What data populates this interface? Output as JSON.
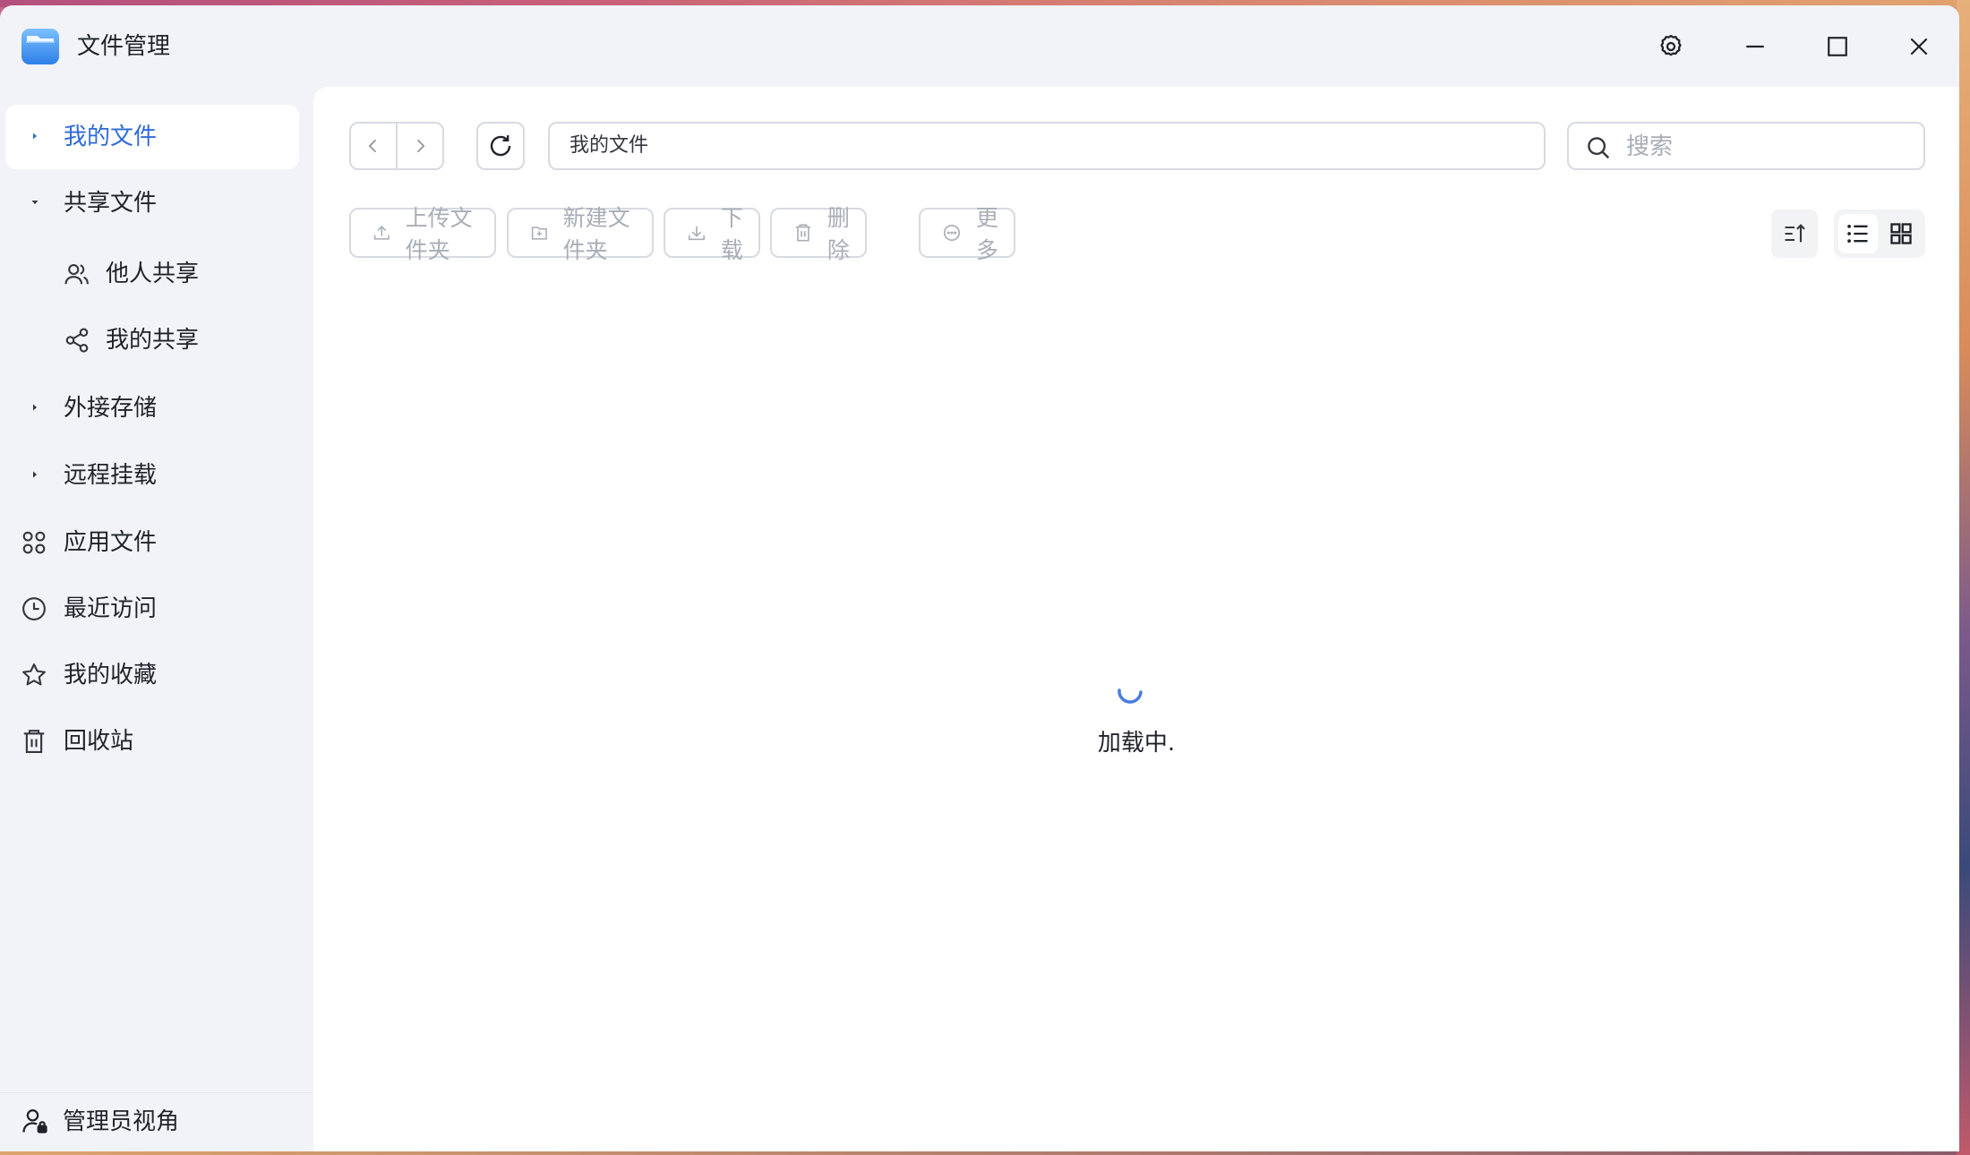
{
  "window": {
    "title": "文件管理",
    "icon": "folder-app-icon"
  },
  "titlebar_controls": [
    "gear-icon",
    "minimize-icon",
    "maximize-icon",
    "close-icon"
  ],
  "sidebar": {
    "items": [
      {
        "label": "我的文件",
        "icon": "caret-right-icon",
        "active": true
      },
      {
        "label": "共享文件",
        "icon": "caret-down-icon",
        "expanded": true
      },
      {
        "label": "他人共享",
        "icon": "users-icon",
        "child": true
      },
      {
        "label": "我的共享",
        "icon": "share-icon",
        "child": true
      },
      {
        "label": "外接存储",
        "icon": "caret-right-icon"
      },
      {
        "label": "远程挂载",
        "icon": "caret-right-icon"
      },
      {
        "label": "应用文件",
        "icon": "apps-icon"
      },
      {
        "label": "最近访问",
        "icon": "clock-icon"
      },
      {
        "label": "我的收藏",
        "icon": "star-icon"
      },
      {
        "label": "回收站",
        "icon": "trash-icon"
      }
    ],
    "footer": {
      "label": "管理员视角",
      "icon": "admin-user-icon"
    }
  },
  "toolbar": {
    "path": "我的文件",
    "search_placeholder": "搜索",
    "actions": [
      {
        "label": "上传文件夹",
        "icon": "upload-icon"
      },
      {
        "label": "新建文件夹",
        "icon": "new-folder-icon"
      },
      {
        "label": "下载",
        "icon": "download-icon"
      },
      {
        "label": "删除",
        "icon": "trash-icon"
      },
      {
        "label": "更多",
        "icon": "more-icon"
      }
    ],
    "view_mode": "list"
  },
  "content": {
    "loading_text": "加载中."
  },
  "colors": {
    "accent": "#2e6bd6",
    "sidebar_bg": "#f2f3f8",
    "main_bg": "#ffffff",
    "disabled_text": "#a8adb6"
  }
}
